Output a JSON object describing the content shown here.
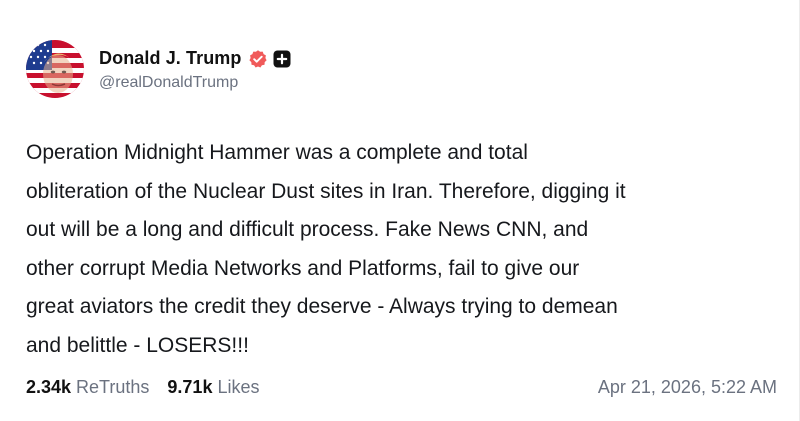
{
  "author": {
    "display_name": "Donald J. Trump",
    "handle": "@realDonaldTrump",
    "avatar_icon": "avatar-flag-portrait",
    "verified_icon": "verified-badge-icon",
    "verified_color": "#f05a5a",
    "extra_icon": "plus-box-icon"
  },
  "post": {
    "lines": [
      "Operation Midnight Hammer was a complete and total",
      "obliteration of the Nuclear Dust sites in Iran. Therefore, digging it",
      "out will be a long and difficult process. Fake News CNN, and",
      "other corrupt Media Networks and Platforms, fail to give our",
      "great aviators the credit they deserve - Always trying to demean",
      "and belittle - LOSERS!!!"
    ]
  },
  "stats": {
    "retruths_count": "2.34k",
    "retruths_label": "ReTruths",
    "likes_count": "9.71k",
    "likes_label": "Likes"
  },
  "timestamp": "Apr 21, 2026, 5:22 AM",
  "colors": {
    "text_primary": "#111111",
    "text_secondary": "#6b7280",
    "background": "#ffffff"
  }
}
